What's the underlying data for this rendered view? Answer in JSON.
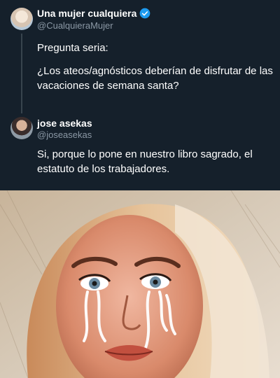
{
  "tweet": {
    "author_name": "Una mujer cualquiera",
    "author_handle": "@CualquieraMujer",
    "verified": true,
    "text_line1": "Pregunta seria:",
    "text_line2": "¿Los ateos/agnósticos deberían de disfrutar de las vacaciones de semana santa?"
  },
  "reply": {
    "author_name": "jose asekas",
    "author_handle": "@joseasekas",
    "text": "Si, porque lo pone en nuestro libro sagrado, el estatuto de los trabajadores."
  },
  "colors": {
    "background": "#15202b",
    "secondary_text": "#8b98a5",
    "verified_blue": "#1d9bf0"
  }
}
